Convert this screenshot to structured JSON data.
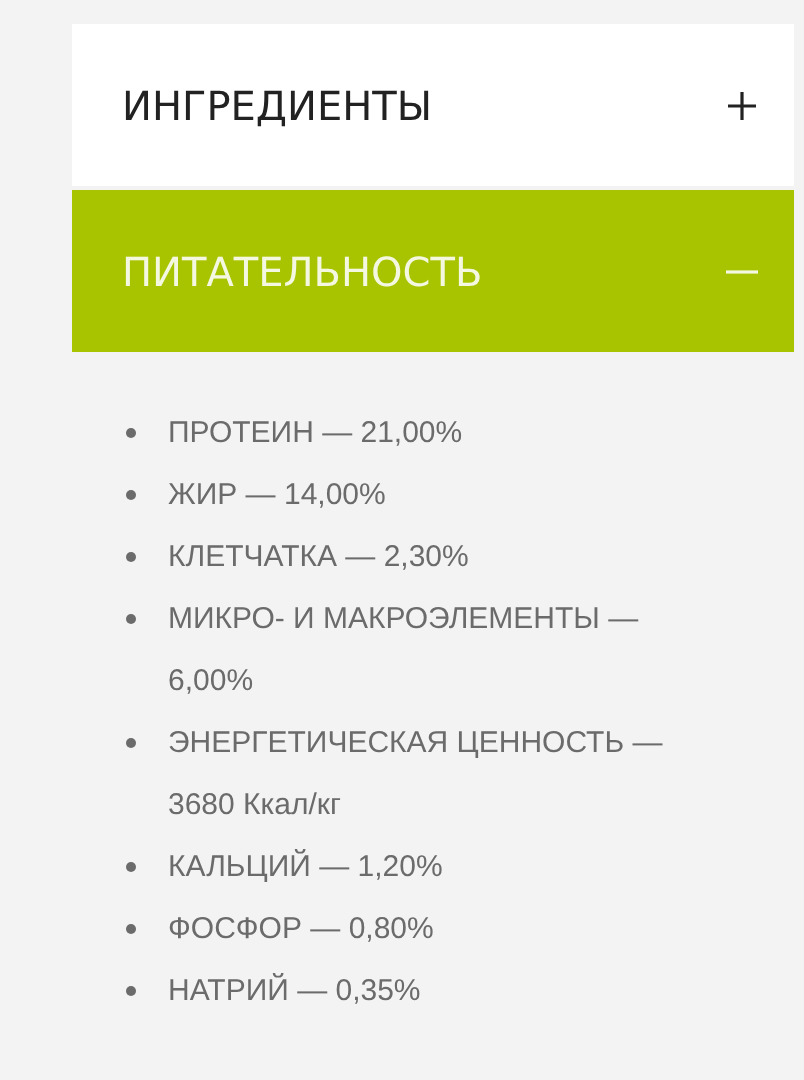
{
  "accordion": [
    {
      "title": "ИНГРЕДИЕНТЫ",
      "expanded": false
    },
    {
      "title": "ПИТАТЕЛЬНОСТЬ",
      "expanded": true,
      "items": [
        "ПРОТЕИН — 21,00%",
        "ЖИР — 14,00%",
        "КЛЕТЧАТКА — 2,30%",
        "МИКРО- И МАКРОЭЛЕМЕНТЫ — 6,00%",
        "ЭНЕРГЕТИЧЕСКАЯ ЦЕННОСТЬ — 3680 Ккал/кг",
        "КАЛЬЦИЙ — 1,20%",
        "ФОСФОР — 0,80%",
        "НАТРИЙ — 0,35%"
      ]
    }
  ]
}
